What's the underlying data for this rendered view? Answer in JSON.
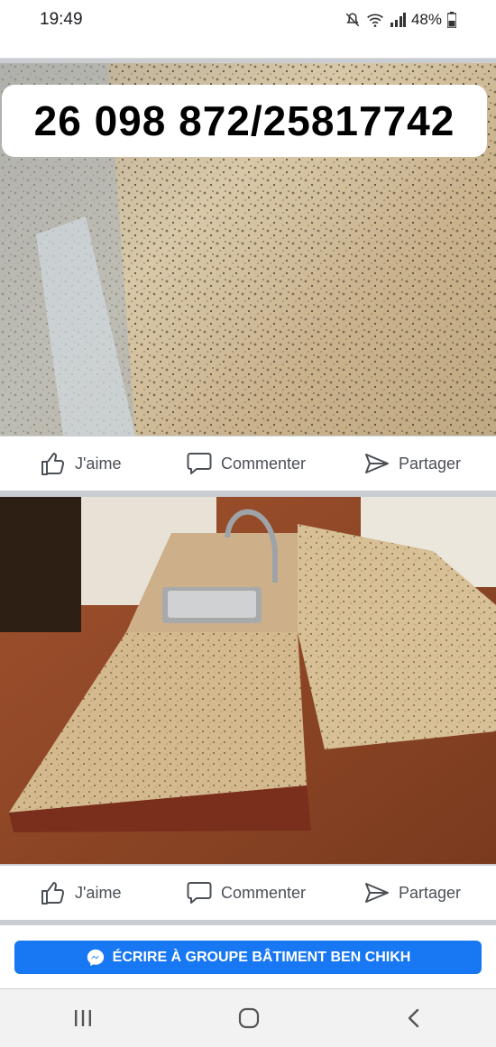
{
  "status": {
    "time": "19:49",
    "battery": "48%"
  },
  "post1": {
    "phone_text": "26 098 872/25817742"
  },
  "actions": {
    "like": "J'aime",
    "comment": "Commenter",
    "share": "Partager"
  },
  "messenger": {
    "label": "ÉCRIRE À GROUPE BÂTIMENT BEN CHIKH"
  },
  "icons": {
    "like": "thumbs-up-icon",
    "comment": "comment-bubble-icon",
    "share": "share-arrow-icon",
    "messenger": "messenger-icon",
    "recents": "recent-apps-icon",
    "home": "home-icon",
    "back": "back-icon"
  },
  "colors": {
    "brand": "#1877f2",
    "action_text": "#4b4f56"
  }
}
